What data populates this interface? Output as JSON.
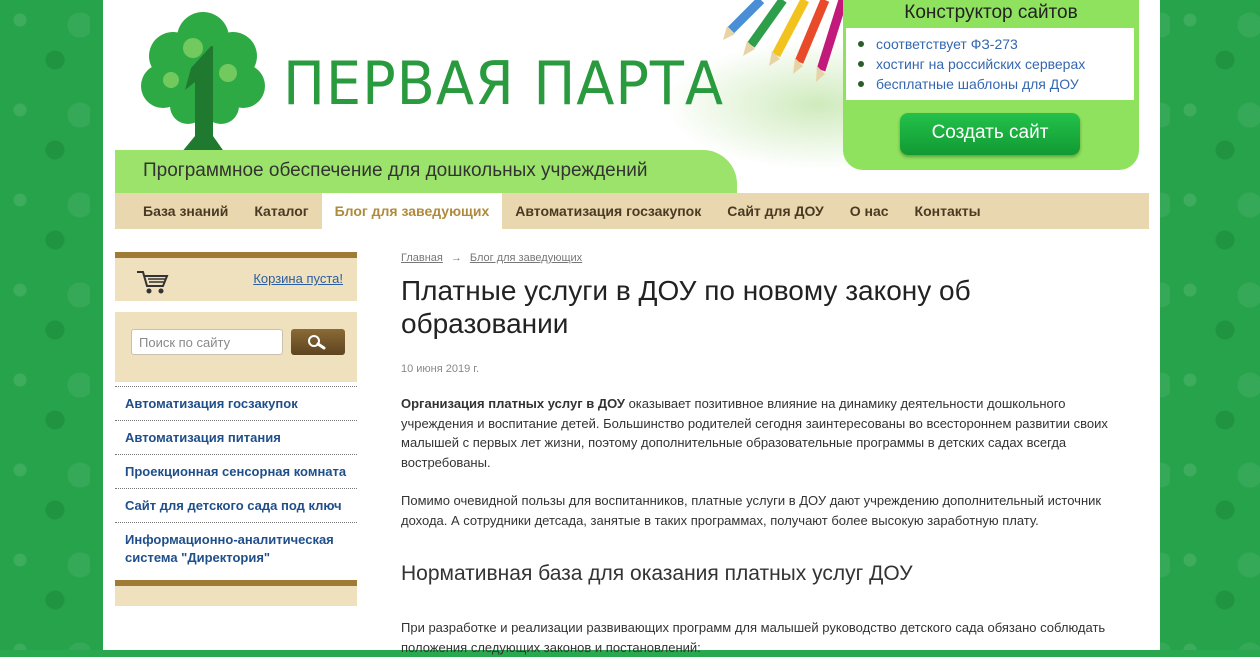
{
  "header": {
    "logo_text": "ПЕРВАЯ ПАРТА",
    "subtitle": "Программное обеспечение для дошкольных учреждений",
    "promo": {
      "title": "Конструктор сайтов",
      "items": [
        "соответствует ФЗ-273",
        "хостинг на российских серверах",
        "бесплатные шаблоны для ДОУ"
      ],
      "button_label": "Создать сайт"
    }
  },
  "nav": {
    "items": [
      {
        "label": "База знаний"
      },
      {
        "label": "Каталог"
      },
      {
        "label": "Блог для заведующих"
      },
      {
        "label": "Автоматизация госзакупок"
      },
      {
        "label": "Сайт для ДОУ"
      },
      {
        "label": "О нас"
      },
      {
        "label": "Контакты"
      }
    ],
    "active_index": 2
  },
  "sidebar": {
    "cart_icon": "shopping-cart-icon",
    "cart_label": "Корзина пуста!",
    "search_placeholder": "Поиск по сайту",
    "search_icon": "magnifier-icon",
    "menu": [
      {
        "label": "Автоматизация госзакупок"
      },
      {
        "label": "Автоматизация питания"
      },
      {
        "label": "Проекционная сенсорная комната"
      },
      {
        "label": "Сайт для детского сада под ключ"
      },
      {
        "label": "Информационно-аналитическая система \"Директория\""
      }
    ]
  },
  "content": {
    "breadcrumbs": [
      "Главная",
      "Блог для заведующих"
    ],
    "breadcrumb_separator": "→",
    "title": "Платные услуги в ДОУ по новому закону об образовании",
    "date": "10 июня 2019 г.",
    "p1_bold": "Организация платных услуг в ДОУ",
    "p1_rest": " оказывает позитивное влияние на динамику деятельности дошкольного учреждения и воспитание детей. Большинство родителей сегодня заинтересованы во всестороннем развитии своих малышей с первых лет жизни, поэтому дополнительные образовательные программы в детских садах всегда востребованы.",
    "p2": "Помимо очевидной пользы для воспитанников, платные услуги в ДОУ дают учреждению дополнительный источник дохода. А сотрудники детсада, занятые в таких программах, получают более высокую заработную плату.",
    "h2": "Нормативная база для оказания платных услуг ДОУ",
    "p3": "При разработке и реализации развивающих программ для малышей руководство детского сада обязано соблюдать положения следующих законов и постановлений:"
  },
  "colors": {
    "background_green": "#27a34b",
    "logo_green": "#2a9a3e",
    "promo_green": "#8fe25d",
    "nav_beige": "#e9d7b0",
    "active_nav_text": "#b08a3c",
    "link_blue": "#1f4f8a",
    "sidebar_brown": "#a07b35"
  }
}
